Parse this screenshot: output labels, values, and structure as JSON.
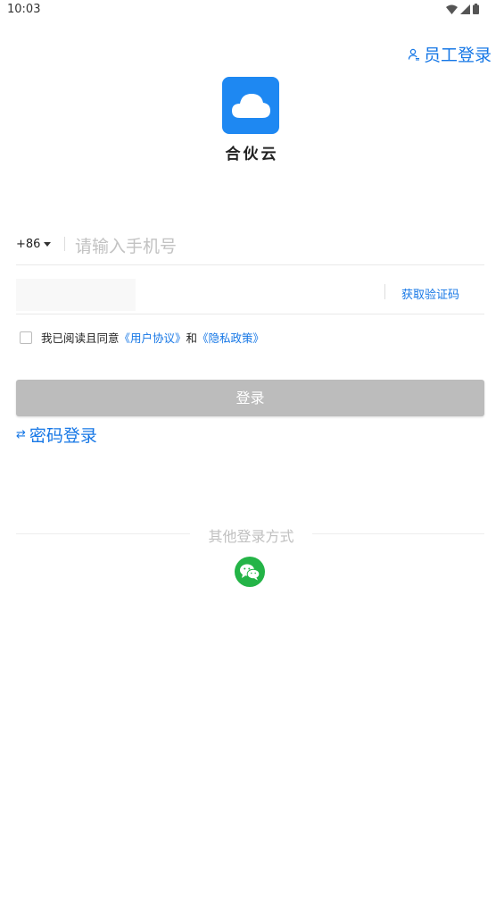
{
  "status_bar": {
    "time": "10:03"
  },
  "header": {
    "staff_login": "员工登录"
  },
  "app": {
    "name": "合伙云",
    "logo_icon": "cloud-icon",
    "logo_color": "#1e88f2"
  },
  "form": {
    "country_code": "+86",
    "phone_placeholder": "请输入手机号",
    "code_value": "",
    "get_code": "获取验证码"
  },
  "agreement": {
    "prefix": "我已阅读且同意",
    "user_agreement": "《用户协议》",
    "and": "和",
    "privacy_policy": "《隐私政策》"
  },
  "actions": {
    "login": "登录",
    "password_login": "密码登录",
    "login_disabled_color": "#bcbcbc"
  },
  "other_login": {
    "label": "其他登录方式",
    "methods": [
      {
        "icon": "wechat-icon",
        "color": "#24b447"
      }
    ]
  },
  "colors": {
    "accent": "#1677e6"
  }
}
